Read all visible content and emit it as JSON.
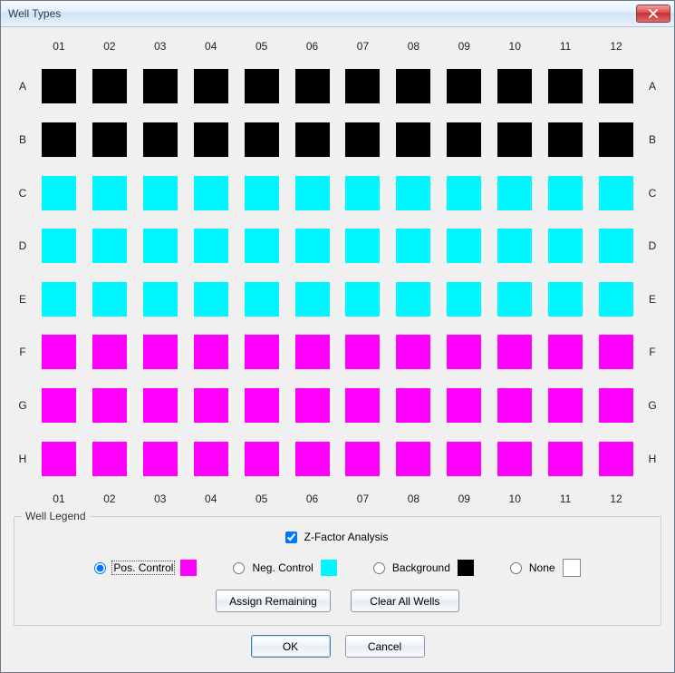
{
  "window": {
    "title": "Well Types"
  },
  "plate": {
    "columns": [
      "01",
      "02",
      "03",
      "04",
      "05",
      "06",
      "07",
      "08",
      "09",
      "10",
      "11",
      "12"
    ],
    "rows": [
      "A",
      "B",
      "C",
      "D",
      "E",
      "F",
      "G",
      "H"
    ],
    "row_types": [
      "background",
      "background",
      "neg",
      "neg",
      "neg",
      "pos",
      "pos",
      "pos"
    ]
  },
  "colors": {
    "pos": "#ff00ff",
    "neg": "#00f6ff",
    "background": "#000000",
    "none": "#ffffff"
  },
  "legend": {
    "title": "Well Legend",
    "zfactor_label": "Z-Factor Analysis",
    "zfactor_checked": true,
    "options": [
      {
        "id": "pos",
        "label": "Pos. Control",
        "checked": true
      },
      {
        "id": "neg",
        "label": "Neg. Control",
        "checked": false
      },
      {
        "id": "background",
        "label": "Background",
        "checked": false
      },
      {
        "id": "none",
        "label": "None",
        "checked": false
      }
    ],
    "assign_remaining": "Assign Remaining",
    "clear_all": "Clear All Wells"
  },
  "footer": {
    "ok": "OK",
    "cancel": "Cancel"
  }
}
